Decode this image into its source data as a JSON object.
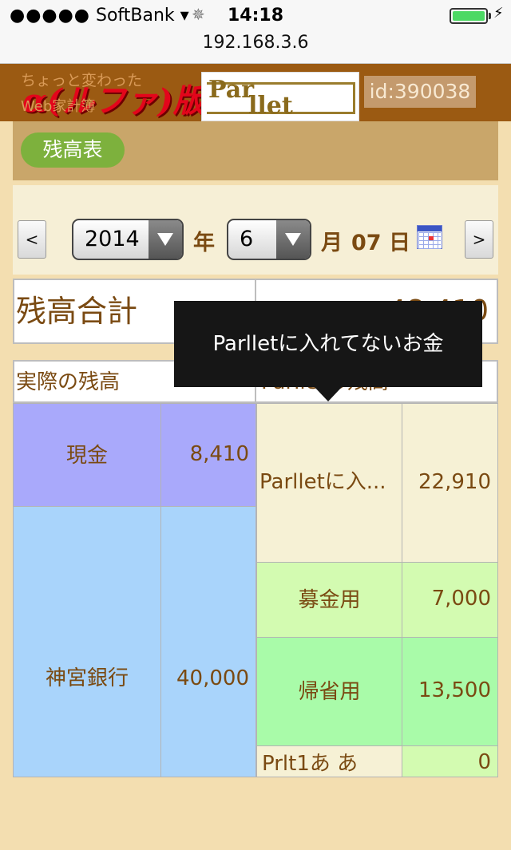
{
  "status_bar": {
    "carrier": "SoftBank",
    "signal_dots": "●●●●●",
    "time": "14:18",
    "battery_level": 1.0
  },
  "url": "192.168.3.6",
  "header": {
    "tagline_1": "ちょっと変わった",
    "tagline_2": "Web家計簿",
    "logo_text": "α(ルファ)版",
    "parllet_logo_1": "Par",
    "parllet_logo_2": "llet",
    "user_id": "id:390038"
  },
  "nav": {
    "balance_sheet_label": "残高表"
  },
  "date_picker": {
    "prev_label": "<",
    "next_label": ">",
    "year_value": "2014",
    "year_label": "年",
    "month_value": "6",
    "month_label": "月",
    "day_text": "07 日"
  },
  "totals": {
    "label": "残高合計",
    "value": "48,410"
  },
  "columns": {
    "actual_header": "実際の残高",
    "parllet_header": "Parlletの残高"
  },
  "actual_rows": [
    {
      "name": "現金",
      "value": "8,410"
    },
    {
      "name": "神宮銀行",
      "value": "40,000"
    }
  ],
  "parllet_rows": [
    {
      "name": "Parlletに入...",
      "value": "22,910"
    },
    {
      "name": "募金用",
      "value": "7,000"
    },
    {
      "name": "帰省用",
      "value": "13,500"
    },
    {
      "name": "Prlt1あ あ",
      "value": "0"
    }
  ],
  "tooltip": {
    "text": "Parlletに入れてないお金"
  },
  "colors": {
    "header_brown": "#9b5a12",
    "pill_green": "#7db13d",
    "cash_purple": "#a9a9fb",
    "bank_blue": "#a9d4fb",
    "fund_light_green": "#d3fbb1",
    "fund_green": "#a9fba9",
    "text_brown": "#7a4a12"
  }
}
